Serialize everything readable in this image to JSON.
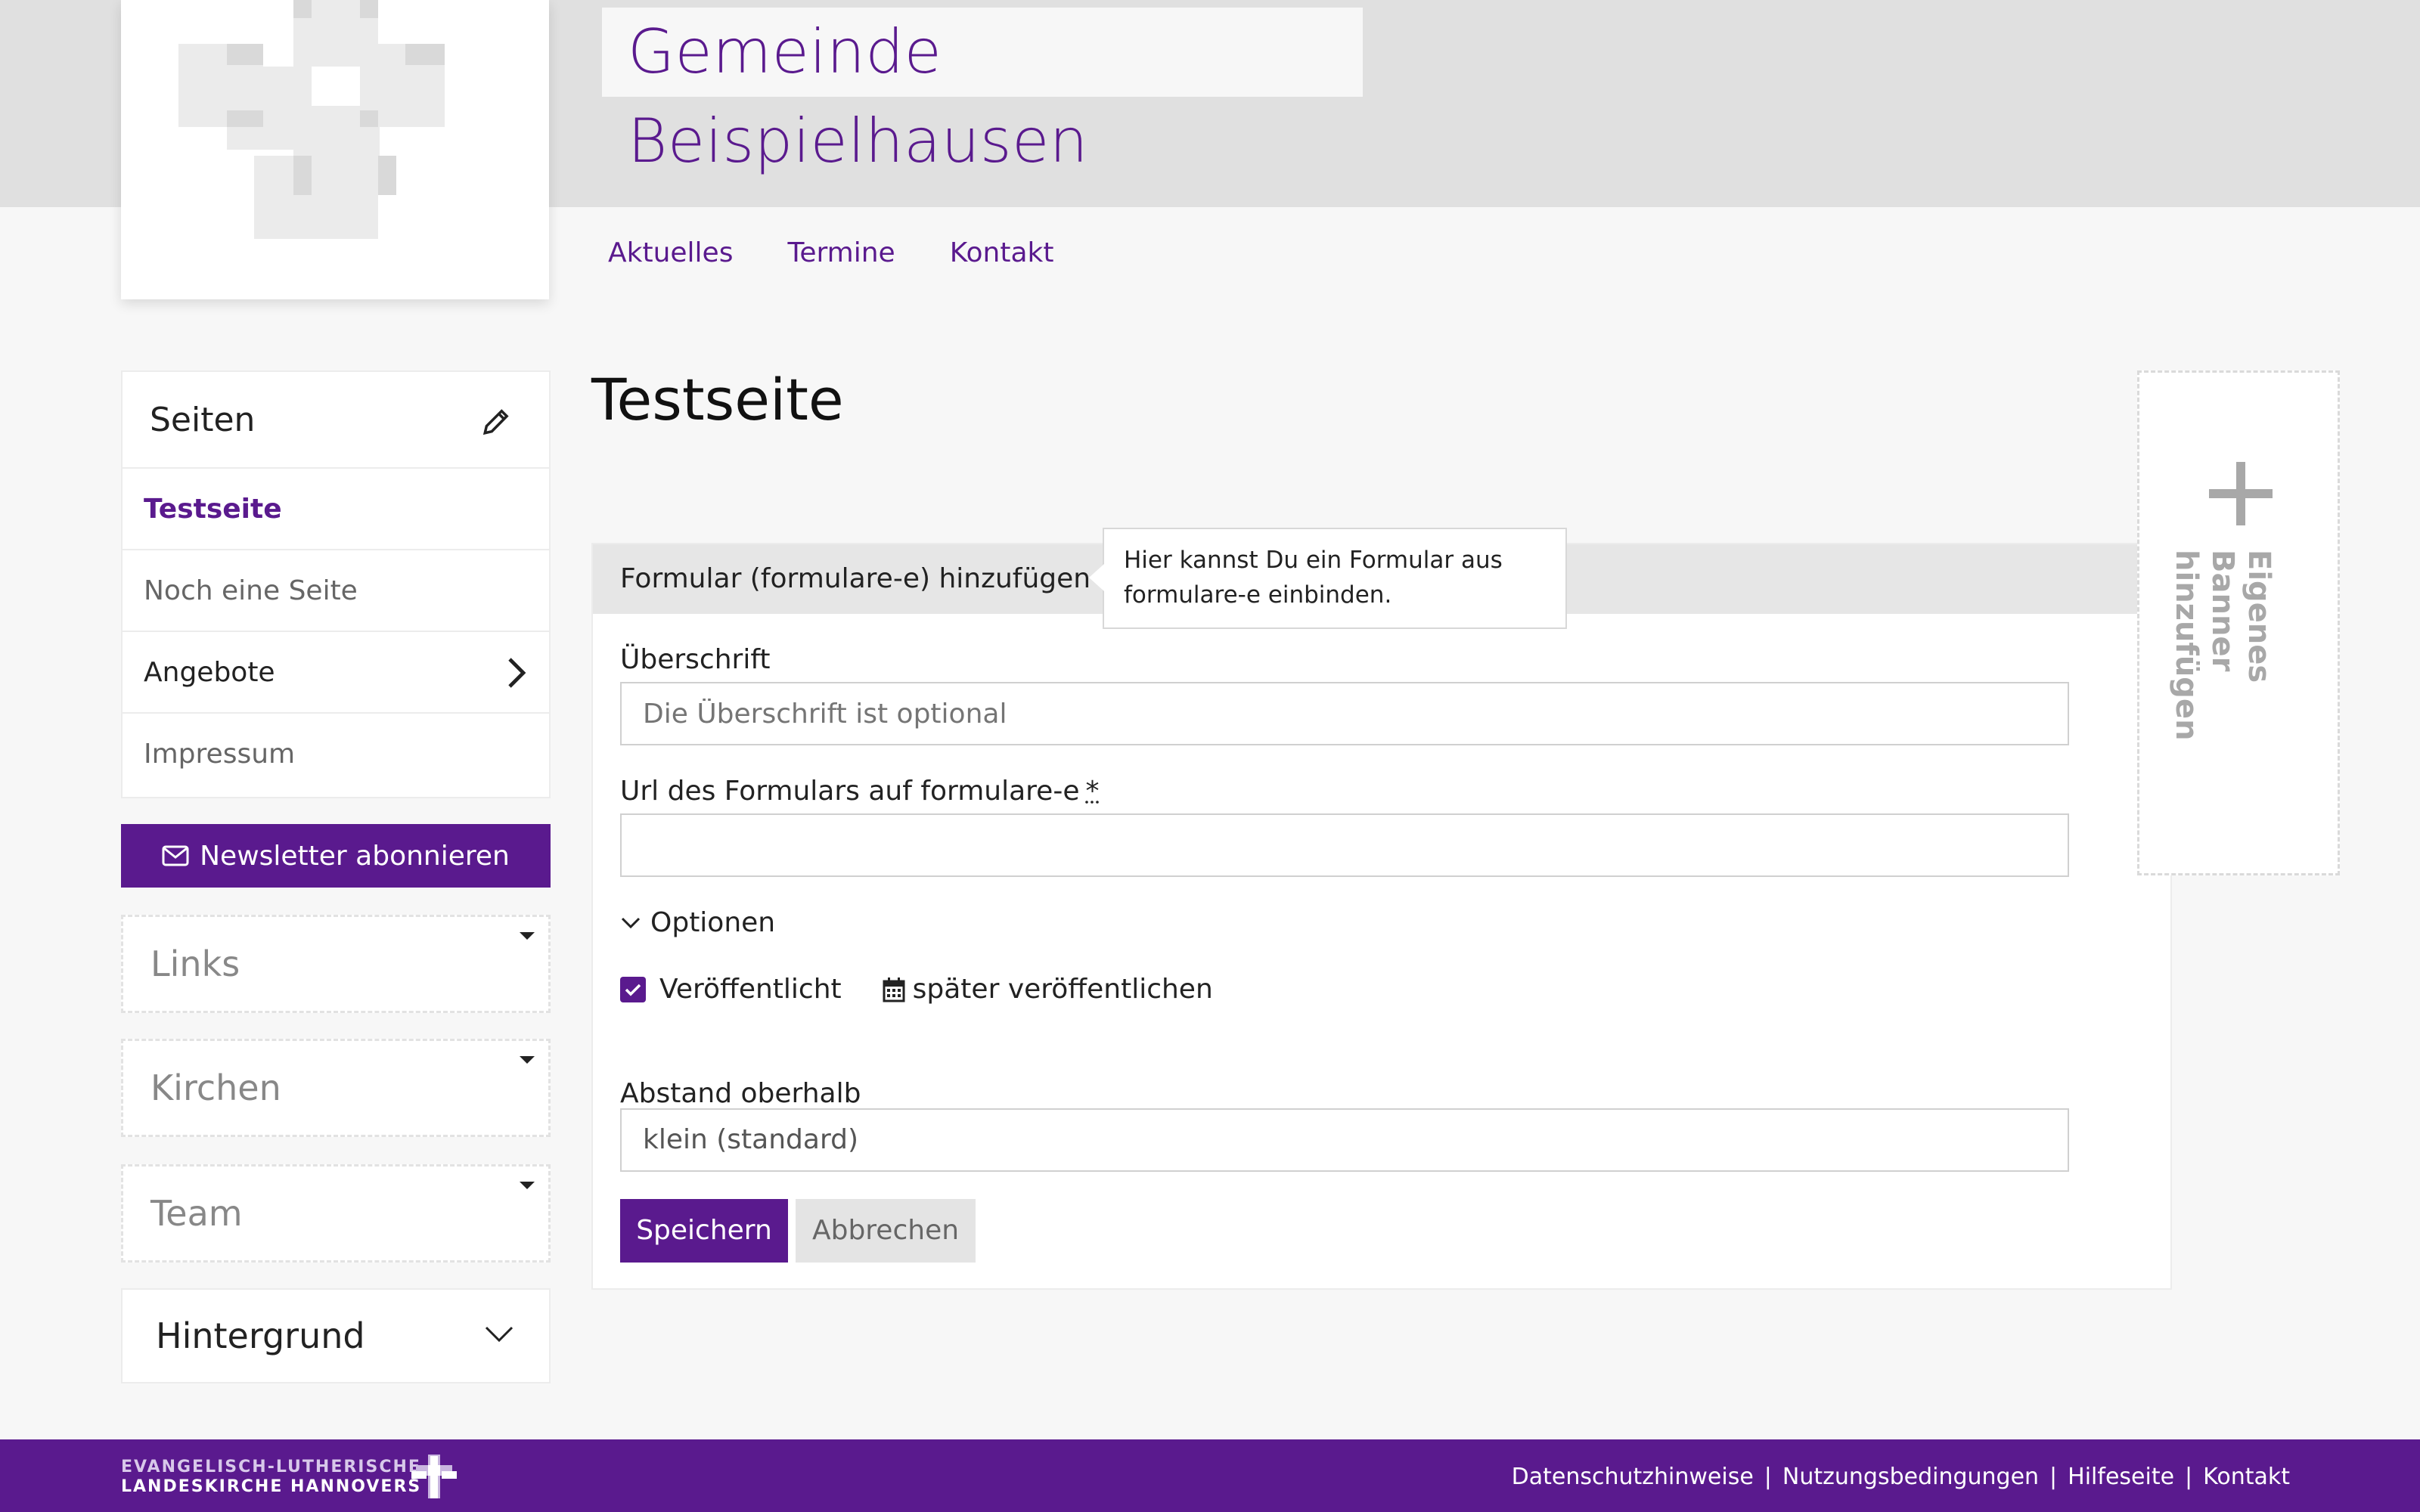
{
  "site": {
    "title": "Gemeinde Beispielhausen"
  },
  "topnav": [
    {
      "label": "Aktuelles"
    },
    {
      "label": "Termine"
    },
    {
      "label": "Kontakt"
    }
  ],
  "sidebar": {
    "pages_title": "Seiten",
    "pages": [
      {
        "label": "Testseite",
        "state": "active"
      },
      {
        "label": "Noch eine Seite"
      },
      {
        "label": "Angebote",
        "has_children": true
      },
      {
        "label": "Impressum"
      }
    ],
    "newsletter_label": "Newsletter abonnieren",
    "collapsibles": [
      {
        "label": "Links"
      },
      {
        "label": "Kirchen"
      },
      {
        "label": "Team"
      }
    ],
    "background_label": "Hintergrund"
  },
  "main": {
    "page_title": "Testseite",
    "form": {
      "header": "Formular (formulare-e) hinzufügen",
      "help_icon": "?",
      "tooltip": "Hier kannst Du ein Formular aus formulare-e einbinden.",
      "heading_label": "Überschrift",
      "heading_placeholder": "Die Überschrift ist optional",
      "url_label": "Url des Formulars auf formulare-e",
      "required_mark": "*",
      "url_value": "",
      "options_label": "Optionen",
      "published_label": "Veröffentlicht",
      "published_checked": true,
      "later_label": "später veröffentlichen",
      "spacing_label": "Abstand oberhalb",
      "spacing_value": "klein (standard)",
      "save_label": "Speichern",
      "cancel_label": "Abbrechen"
    }
  },
  "banner": {
    "label": "Eigenes Banner hinzufügen"
  },
  "footer": {
    "brand_line1": "EVANGELISCH-LUTHERISCHE",
    "brand_line2": "LANDESKIRCHE HANNOVERS",
    "links": [
      {
        "label": "Datenschutzhinweise"
      },
      {
        "label": "Nutzungsbedingungen"
      },
      {
        "label": "Hilfeseite"
      },
      {
        "label": "Kontakt"
      }
    ]
  },
  "colors": {
    "accent": "#5a1a8e",
    "header_gray": "#e0e0e0",
    "page_bg": "#f7f7f7"
  }
}
